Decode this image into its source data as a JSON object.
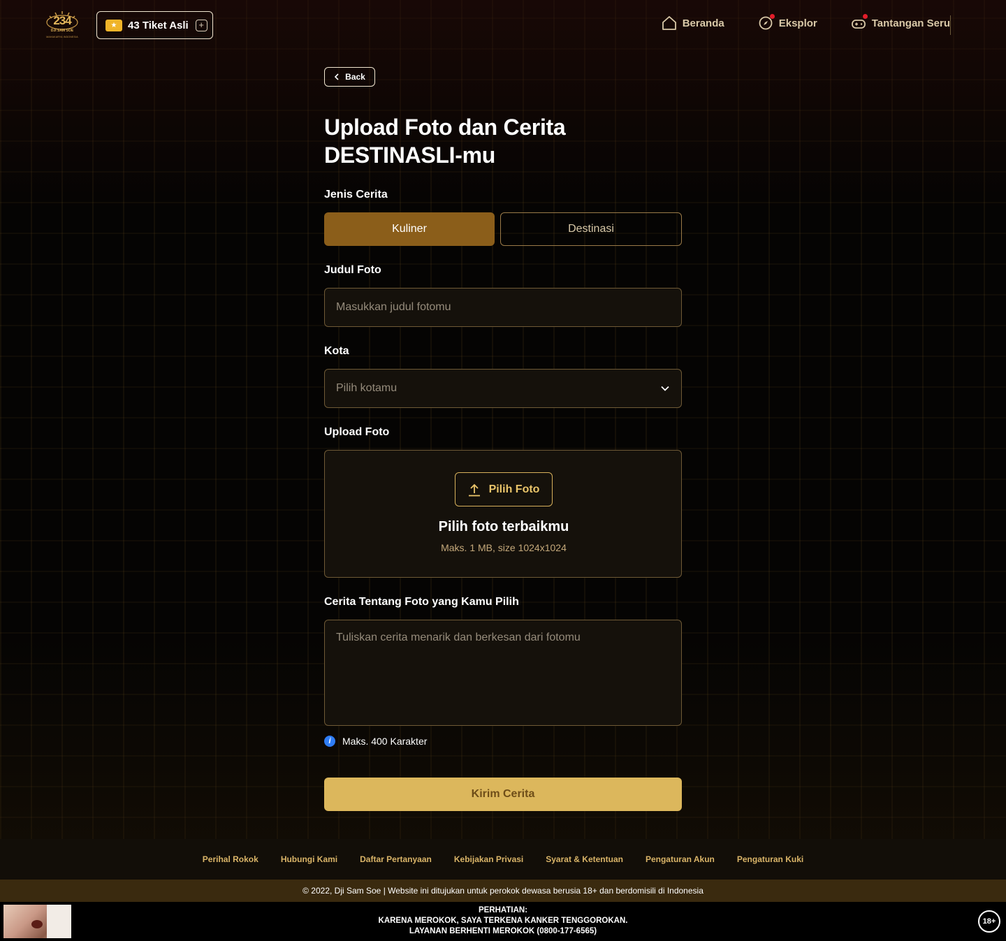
{
  "header": {
    "logo_number": "234",
    "logo_brand": "DJI SAM SOE",
    "logo_tagline": "MAHAKARYA INDONESIA",
    "ticket_label": "43 Tiket Asli",
    "nav": [
      {
        "label": "Beranda",
        "icon": "home-icon",
        "notification": false
      },
      {
        "label": "Eksplor",
        "icon": "compass-icon",
        "notification": true
      },
      {
        "label": "Tantangan Seru",
        "icon": "gamepad-icon",
        "notification": true
      }
    ]
  },
  "main": {
    "back_label": "Back",
    "title_line1": "Upload Foto dan Cerita",
    "title_line2": "DESTINASLI-mu",
    "story_type_label": "Jenis Cerita",
    "story_types": [
      "Kuliner",
      "Destinasi"
    ],
    "selected_story_type": "Kuliner",
    "photo_title_label": "Judul Foto",
    "photo_title_placeholder": "Masukkan judul fotomu",
    "city_label": "Kota",
    "city_placeholder": "Pilih kotamu",
    "upload_label": "Upload Foto",
    "upload_button": "Pilih Foto",
    "upload_title": "Pilih foto terbaikmu",
    "upload_hint": "Maks. 1 MB, size 1024x1024",
    "story_label": "Cerita Tentang Foto yang Kamu Pilih",
    "story_placeholder": "Tuliskan cerita menarik dan berkesan dari fotomu",
    "story_limit": "Maks. 400 Karakter",
    "submit_label": "Kirim Cerita"
  },
  "footer": {
    "links": [
      "Perihal Rokok",
      "Hubungi Kami",
      "Daftar Pertanyaan",
      "Kebijakan Privasi",
      "Syarat & Ketentuan",
      "Pengaturan Akun",
      "Pengaturan Kuki"
    ],
    "copyright": "© 2022, Dji Sam Soe | Website ini ditujukan untuk perokok dewasa berusia 18+ dan berdomisili di Indonesia"
  },
  "warning": {
    "line1": "PERHATIAN:",
    "line2": "KARENA MEROKOK, SAYA TERKENA KANKER TENGGOROKAN.",
    "line3": "LAYANAN BERHENTI MEROKOK (0800-177-6565)",
    "age_badge": "18+"
  },
  "colors": {
    "accent_gold": "#dcb75c",
    "active_segment": "#8b5e1a",
    "field_border": "#6f5a36",
    "notification_dot": "#e11d2a",
    "info_blue": "#2f7df6"
  }
}
